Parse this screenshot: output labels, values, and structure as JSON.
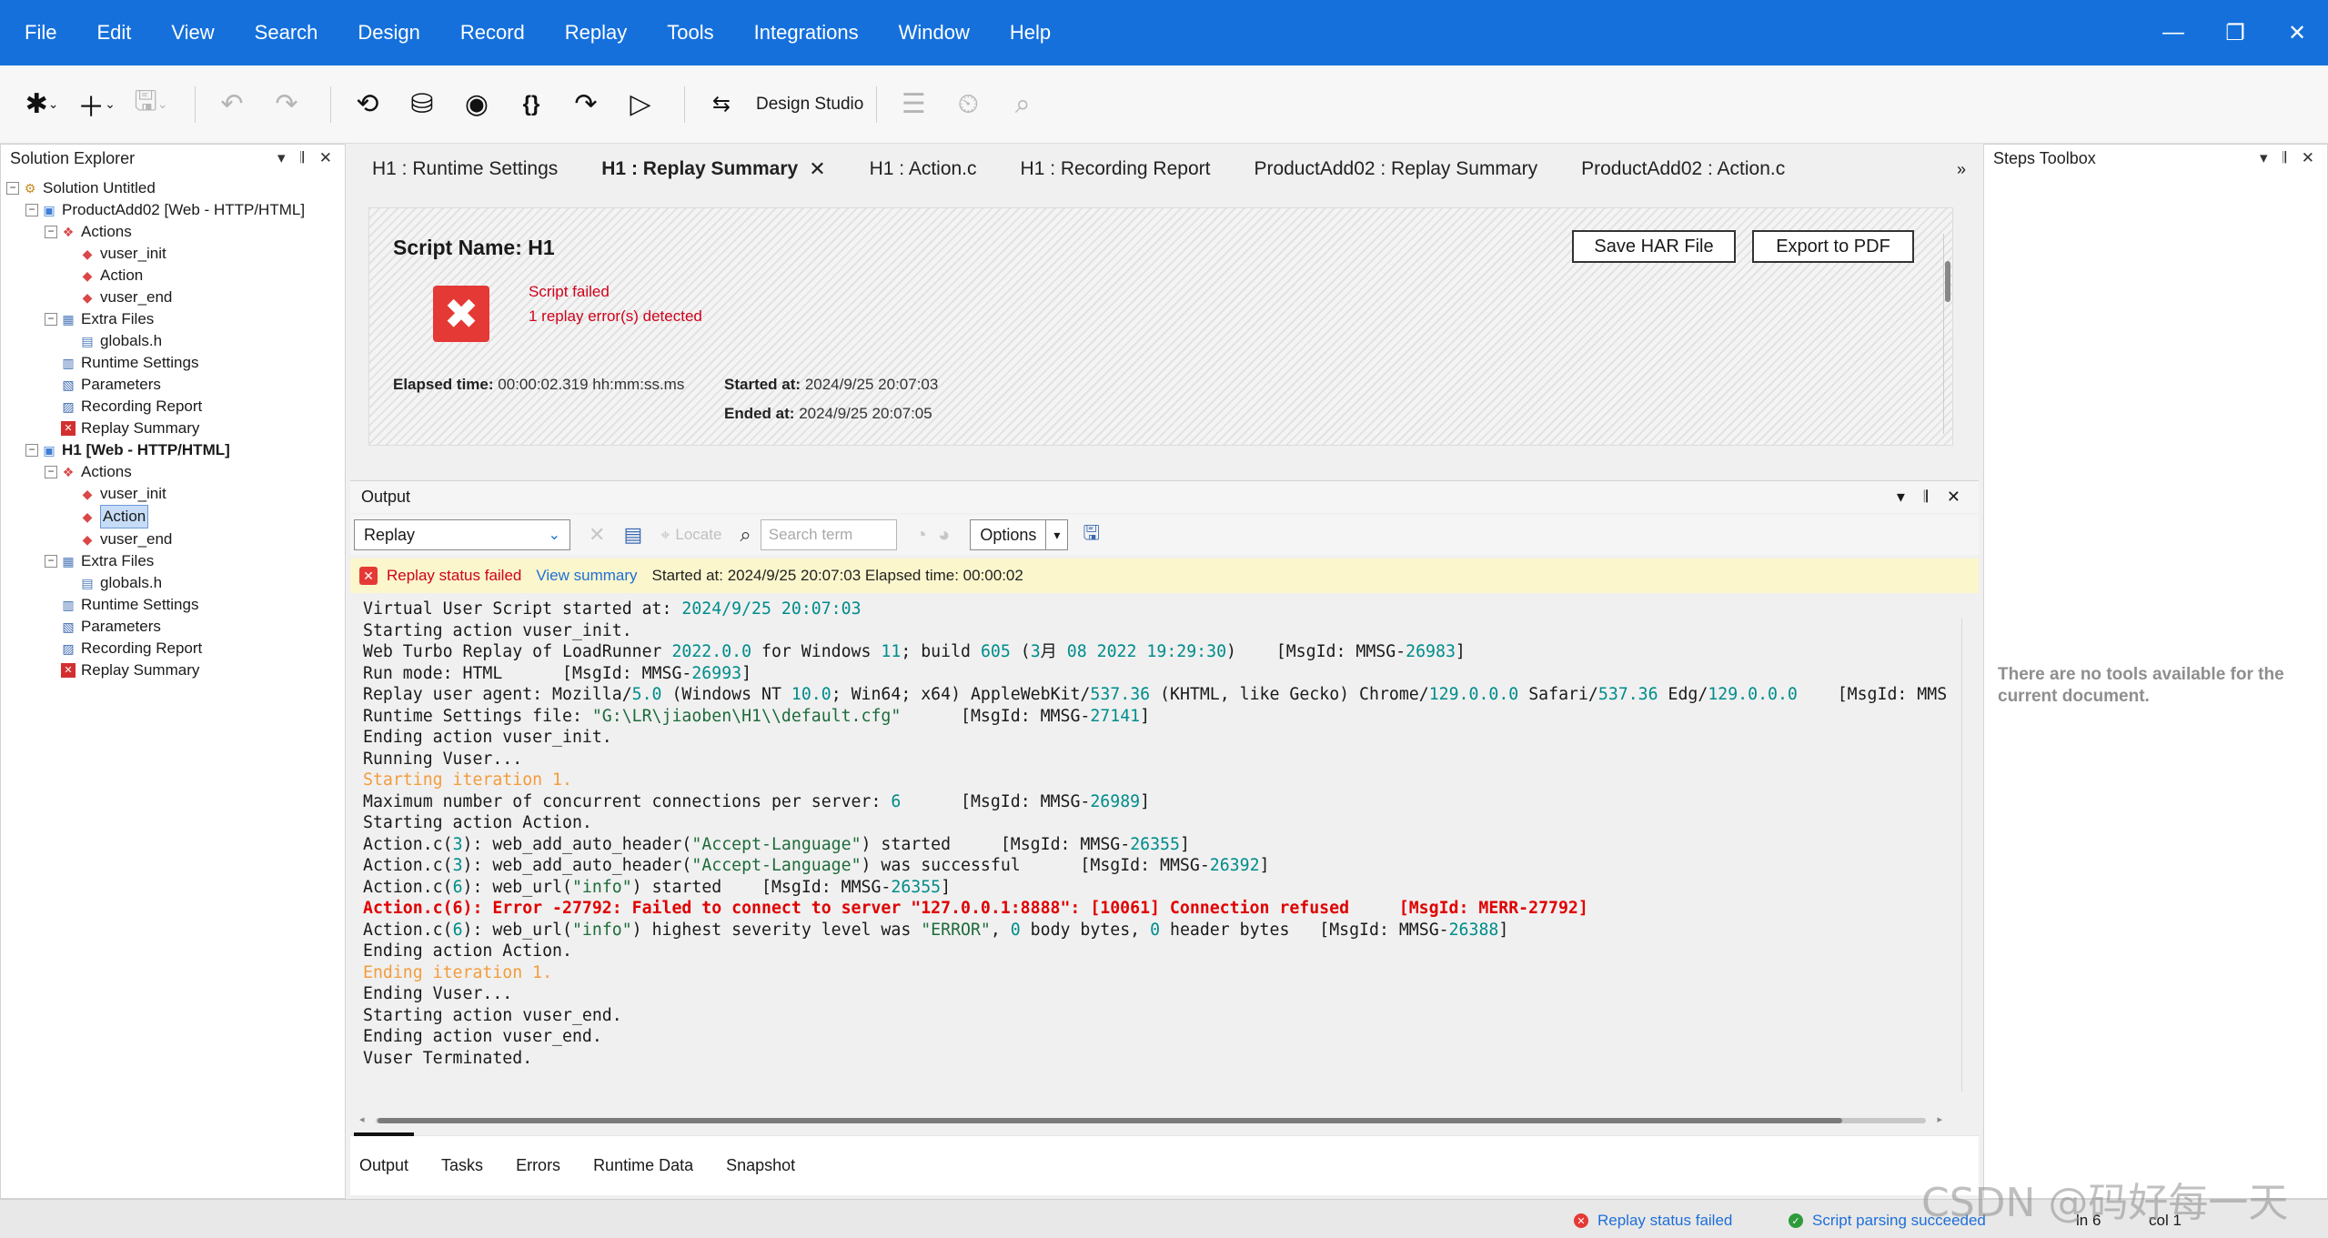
{
  "menu": [
    "File",
    "Edit",
    "View",
    "Search",
    "Design",
    "Record",
    "Replay",
    "Tools",
    "Integrations",
    "Window",
    "Help"
  ],
  "window_controls": {
    "minimize": "—",
    "restore": "❐",
    "close": "✕"
  },
  "toolbar": {
    "design_studio_label": "Design Studio"
  },
  "solution_explorer": {
    "title": "Solution Explorer",
    "tree": [
      {
        "label": "Solution Untitled",
        "indent": 0,
        "icon": "solution-icon",
        "toggle": "−"
      },
      {
        "label": "ProductAdd02 [Web - HTTP/HTML]",
        "indent": 1,
        "icon": "script-icon",
        "toggle": "−"
      },
      {
        "label": "Actions",
        "indent": 2,
        "icon": "actions-icon",
        "toggle": "−"
      },
      {
        "label": "vuser_init",
        "indent": 3,
        "icon": "action-icon"
      },
      {
        "label": "Action",
        "indent": 3,
        "icon": "action-icon"
      },
      {
        "label": "vuser_end",
        "indent": 3,
        "icon": "action-icon"
      },
      {
        "label": "Extra Files",
        "indent": 2,
        "icon": "folder-icon",
        "toggle": "−"
      },
      {
        "label": "globals.h",
        "indent": 3,
        "icon": "file-icon"
      },
      {
        "label": "Runtime Settings",
        "indent": 2,
        "icon": "settings-icon"
      },
      {
        "label": "Parameters",
        "indent": 2,
        "icon": "parameters-icon"
      },
      {
        "label": "Recording Report",
        "indent": 2,
        "icon": "report-icon"
      },
      {
        "label": "Replay Summary",
        "indent": 2,
        "icon": "error-icon"
      },
      {
        "label": "H1 [Web - HTTP/HTML]",
        "indent": 1,
        "icon": "script-icon",
        "toggle": "−",
        "bold": true
      },
      {
        "label": "Actions",
        "indent": 2,
        "icon": "actions-icon",
        "toggle": "−"
      },
      {
        "label": "vuser_init",
        "indent": 3,
        "icon": "action-icon"
      },
      {
        "label": "Action",
        "indent": 3,
        "icon": "action-icon",
        "selected": true
      },
      {
        "label": "vuser_end",
        "indent": 3,
        "icon": "action-icon"
      },
      {
        "label": "Extra Files",
        "indent": 2,
        "icon": "folder-icon",
        "toggle": "−"
      },
      {
        "label": "globals.h",
        "indent": 3,
        "icon": "file-icon"
      },
      {
        "label": "Runtime Settings",
        "indent": 2,
        "icon": "settings-icon"
      },
      {
        "label": "Parameters",
        "indent": 2,
        "icon": "parameters-icon"
      },
      {
        "label": "Recording Report",
        "indent": 2,
        "icon": "report-icon"
      },
      {
        "label": "Replay Summary",
        "indent": 2,
        "icon": "error-icon"
      }
    ]
  },
  "tabs": [
    {
      "label": "H1 : Runtime Settings",
      "active": false
    },
    {
      "label": "H1 : Replay Summary",
      "active": true
    },
    {
      "label": "H1 : Action.c",
      "active": false
    },
    {
      "label": "H1 : Recording Report",
      "active": false
    },
    {
      "label": "ProductAdd02 : Replay Summary",
      "active": false
    },
    {
      "label": "ProductAdd02 : Action.c",
      "active": false
    }
  ],
  "summary": {
    "script_name": "Script Name: H1",
    "save_har": "Save HAR File",
    "export_pdf": "Export to PDF",
    "status_line1": "Script failed",
    "status_line2": "1 replay error(s) detected",
    "elapsed_label": "Elapsed time:",
    "elapsed_value": "00:00:02.319 hh:mm:ss.ms",
    "started_label": "Started at:",
    "started_value": "2024/9/25 20:07:03",
    "ended_label": "Ended at:",
    "ended_value": "2024/9/25 20:07:05"
  },
  "output": {
    "title": "Output",
    "selector": "Replay",
    "locate": "Locate",
    "search_placeholder": "Search term",
    "options": "Options",
    "status_failed": "Replay status failed",
    "view_summary": "View summary",
    "status_info": "Started at: 2024/9/25 20:07:03 Elapsed time: 00:00:02",
    "log": [
      "Virtual User Script started at: 2024/9/25 20:07:03",
      "Starting action vuser_init.",
      "Web Turbo Replay of LoadRunner 2022.0.0 for Windows 11; build 605 (3月 08 2022 19:29:30)    [MsgId: MMSG-26983]",
      "Run mode: HTML      [MsgId: MMSG-26993]",
      "Replay user agent: Mozilla/5.0 (Windows NT 10.0; Win64; x64) AppleWebKit/537.36 (KHTML, like Gecko) Chrome/129.0.0.0 Safari/537.36 Edg/129.0.0.0    [MsgId: MMS",
      "Runtime Settings file: \"G:\\LR\\jiaoben\\H1\\\\default.cfg\"      [MsgId: MMSG-27141]",
      "Ending action vuser_init.",
      "Running Vuser...",
      "Starting iteration 1.",
      "Maximum number of concurrent connections per server: 6      [MsgId: MMSG-26989]",
      "Starting action Action.",
      "Action.c(3): web_add_auto_header(\"Accept-Language\") started     [MsgId: MMSG-26355]",
      "Action.c(3): web_add_auto_header(\"Accept-Language\") was successful      [MsgId: MMSG-26392]",
      "Action.c(6): web_url(\"info\") started    [MsgId: MMSG-26355]",
      "Action.c(6): Error -27792: Failed to connect to server \"127.0.0.1:8888\": [10061] Connection refused     [MsgId: MERR-27792]",
      "Action.c(6): web_url(\"info\") highest severity level was \"ERROR\", 0 body bytes, 0 header bytes   [MsgId: MMSG-26388]",
      "Ending action Action.",
      "Ending iteration 1.",
      "Ending Vuser...",
      "Starting action vuser_end.",
      "Ending action vuser_end.",
      "Vuser Terminated."
    ],
    "bottom_tabs": [
      "Output",
      "Tasks",
      "Errors",
      "Runtime Data",
      "Snapshot"
    ]
  },
  "steps_toolbox": {
    "title": "Steps Toolbox",
    "empty_message": "There are no tools available for the current document."
  },
  "statusbar": {
    "replay_status": "Replay status failed",
    "parse_status": "Script parsing succeeded",
    "line": "ln 6",
    "col": "col 1"
  },
  "watermark": "CSDN @码好每一天",
  "colors": {
    "accent": "#1570dc",
    "error": "#d0021b",
    "success": "#2e9b3a",
    "number": "#008c8c",
    "string": "#1d6b3a",
    "iteration": "#f39c3c"
  }
}
